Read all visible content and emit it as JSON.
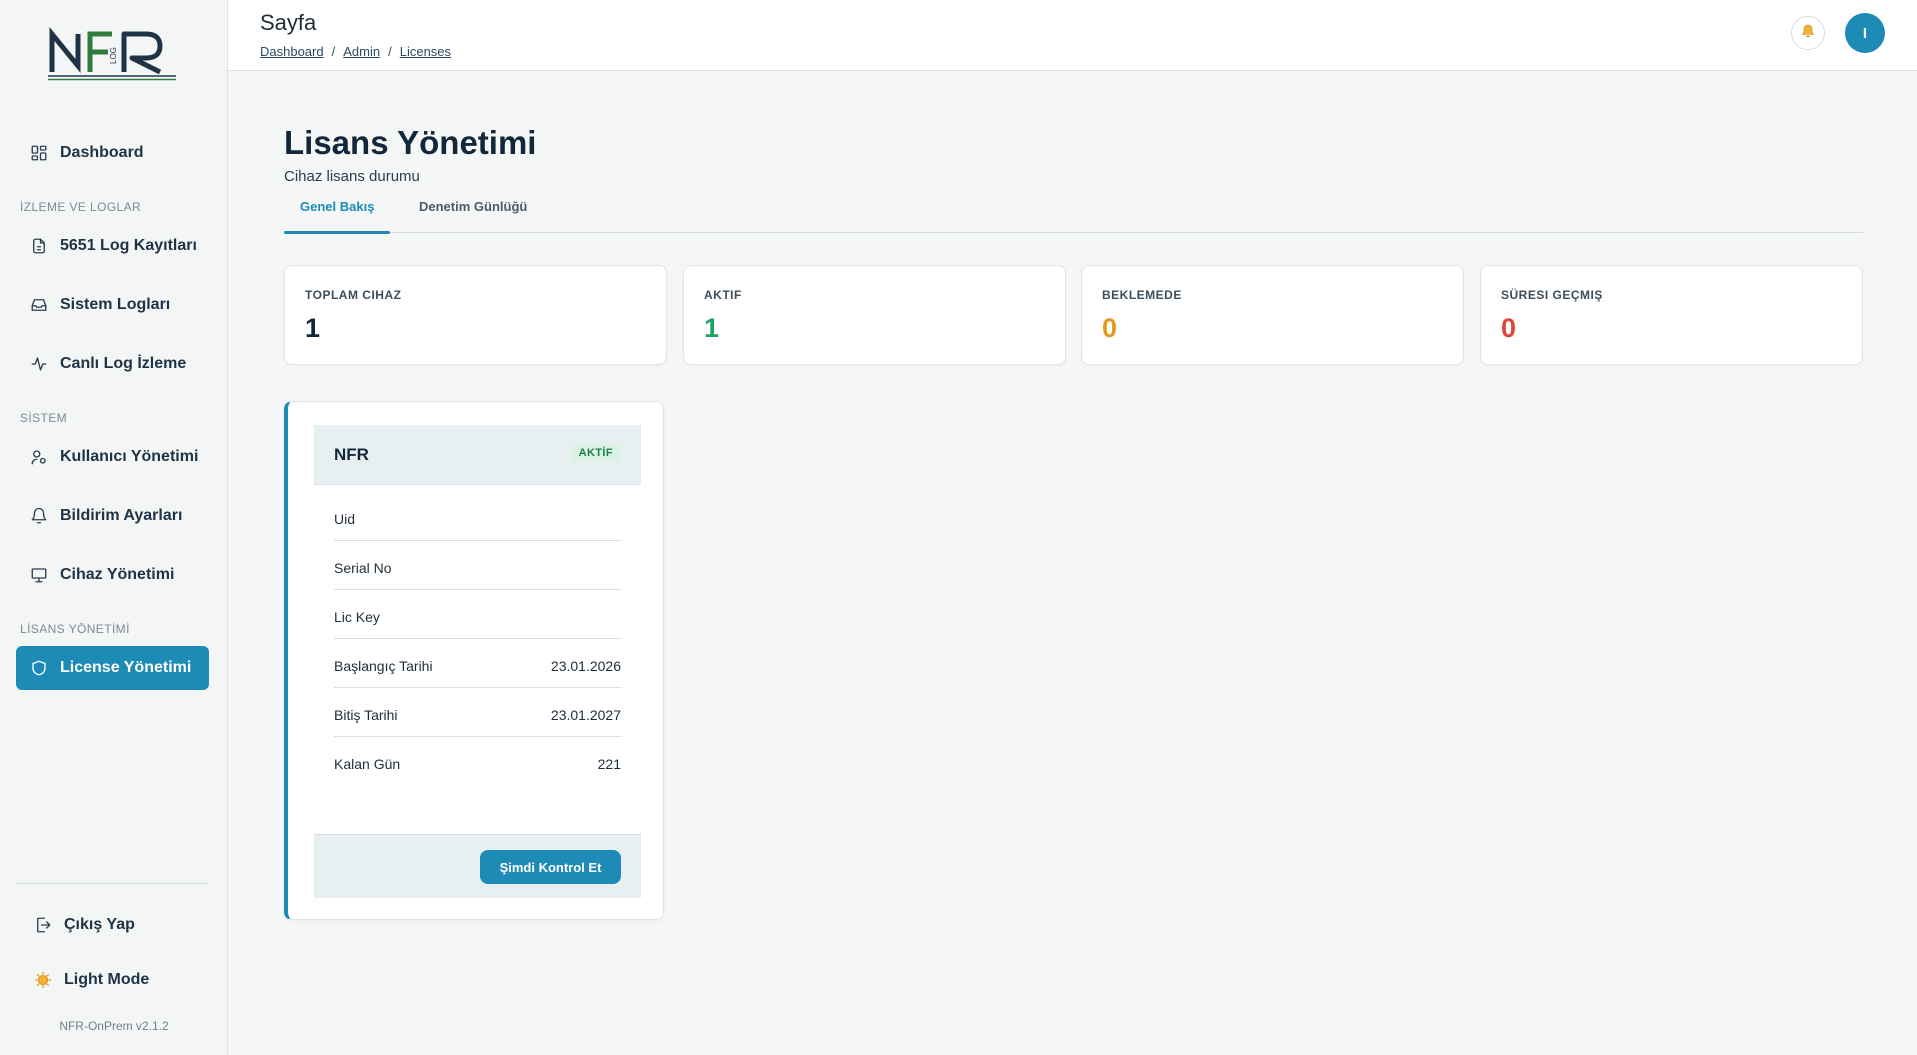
{
  "app": {
    "logo_text": "NFR",
    "logo_sub": "LOG",
    "version": "NFR-OnPrem v2.1.2"
  },
  "colors": {
    "accent": "#1d8bb5",
    "active_green": "#1fa363",
    "pending_orange": "#e39a1c",
    "expired_red": "#e0443a"
  },
  "sidebar": {
    "dashboard": {
      "label": "Dashboard",
      "icon": "grid-icon"
    },
    "sections": {
      "monitoring": "İZLEME VE LOGLAR",
      "system": "SİSTEM",
      "license": "LİSANS YÖNETİMİ"
    },
    "monitoring_items": [
      {
        "label": "5651 Log Kayıtları",
        "icon": "file-icon"
      },
      {
        "label": "Sistem Logları",
        "icon": "inbox-icon"
      },
      {
        "label": "Canlı Log İzleme",
        "icon": "activity-icon"
      }
    ],
    "system_items": [
      {
        "label": "Kullanıcı Yönetimi",
        "icon": "user-icon"
      },
      {
        "label": "Bildirim Ayarları",
        "icon": "bell-icon"
      },
      {
        "label": "Cihaz Yönetimi",
        "icon": "monitor-icon"
      }
    ],
    "license_items": [
      {
        "label": "License Yönetimi",
        "icon": "shield-icon"
      }
    ],
    "logout": {
      "label": "Çıkış Yap",
      "icon": "logout-icon"
    },
    "theme": {
      "label": "Light Mode",
      "icon": "sun-icon"
    }
  },
  "header": {
    "title": "Sayfa",
    "breadcrumb": [
      "Dashboard",
      "Admin",
      "Licenses"
    ],
    "breadcrumb_sep": "/",
    "avatar_initial": "I"
  },
  "main": {
    "title": "Lisans Yönetimi",
    "subtitle": "Cihaz lisans durumu",
    "tabs": [
      {
        "label": "Genel Bakış",
        "active": true
      },
      {
        "label": "Denetim Günlüğü",
        "active": false
      }
    ],
    "stats": [
      {
        "label": "TOPLAM CIHAZ",
        "value": "1"
      },
      {
        "label": "AKTIF",
        "value": "1"
      },
      {
        "label": "BEKLEMEDE",
        "value": "0"
      },
      {
        "label": "SÜRESI GEÇMIŞ",
        "value": "0"
      }
    ],
    "license_card": {
      "name": "NFR",
      "status": "AKTİF",
      "rows": [
        {
          "key": "Uid",
          "value": ""
        },
        {
          "key": "Serial No",
          "value": ""
        },
        {
          "key": "Lic Key",
          "value": ""
        },
        {
          "key": "Başlangıç Tarihi",
          "value": "23.01.2026"
        },
        {
          "key": "Bitiş Tarihi",
          "value": "23.01.2027"
        },
        {
          "key": "Kalan Gün",
          "value": "221"
        }
      ],
      "action_label": "Şimdi Kontrol Et"
    }
  }
}
